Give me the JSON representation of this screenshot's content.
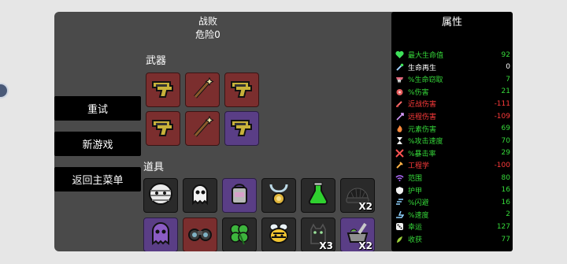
{
  "header": {
    "result": "战败",
    "danger": "危险0"
  },
  "menu": {
    "retry": "重试",
    "new_game": "新游戏",
    "main_menu": "返回主菜单"
  },
  "weapons": {
    "title": "武器",
    "items": [
      {
        "icon": "gun-icon",
        "tier": "red"
      },
      {
        "icon": "wand-icon",
        "tier": "red"
      },
      {
        "icon": "gun-icon",
        "tier": "red"
      },
      {
        "icon": "gun-icon",
        "tier": "red"
      },
      {
        "icon": "wand-icon",
        "tier": "red"
      },
      {
        "icon": "gun-icon",
        "tier": "purple"
      }
    ]
  },
  "items": {
    "title": "道具",
    "list": [
      {
        "icon": "mummy-head-icon",
        "tier": "gray",
        "qty": ""
      },
      {
        "icon": "ghost-icon",
        "tier": "gray",
        "qty": ""
      },
      {
        "icon": "canister-icon",
        "tier": "purple",
        "qty": ""
      },
      {
        "icon": "amulet-icon",
        "tier": "gray",
        "qty": ""
      },
      {
        "icon": "potion-flask-icon",
        "tier": "gray",
        "qty": ""
      },
      {
        "icon": "beanie-hat-icon",
        "tier": "gray",
        "qty": "X2"
      },
      {
        "icon": "purple-ghost-icon",
        "tier": "purple",
        "qty": ""
      },
      {
        "icon": "binoculars-icon",
        "tier": "red",
        "qty": ""
      },
      {
        "icon": "clover-icon",
        "tier": "gray",
        "qty": ""
      },
      {
        "icon": "bee-icon",
        "tier": "gray",
        "qty": ""
      },
      {
        "icon": "dark-cat-icon",
        "tier": "gray",
        "qty": "X3"
      },
      {
        "icon": "mortar-icon",
        "tier": "purple",
        "qty": "X2"
      }
    ]
  },
  "stats": {
    "title": "属性",
    "rows": [
      {
        "icon": "heart-icon",
        "label": "最大生命值",
        "value": "92",
        "color": "#36d93a"
      },
      {
        "icon": "regen-icon",
        "label": "生命再生",
        "value": "0",
        "color": "#ffffff"
      },
      {
        "icon": "lifesteal-icon",
        "label": "%生命窃取",
        "value": "7",
        "color": "#36d93a"
      },
      {
        "icon": "damage-icon",
        "label": "%伤害",
        "value": "21",
        "color": "#36d93a"
      },
      {
        "icon": "melee-icon",
        "label": "近战伤害",
        "value": "-111",
        "color": "#ff3b3b"
      },
      {
        "icon": "ranged-icon",
        "label": "远程伤害",
        "value": "-109",
        "color": "#ff3b3b"
      },
      {
        "icon": "elemental-icon",
        "label": "元素伤害",
        "value": "69",
        "color": "#36d93a"
      },
      {
        "icon": "attack-speed-icon",
        "label": "%攻击速度",
        "value": "70",
        "color": "#36d93a"
      },
      {
        "icon": "crit-icon",
        "label": "%暴击率",
        "value": "29",
        "color": "#36d93a"
      },
      {
        "icon": "engineering-icon",
        "label": "工程学",
        "value": "-100",
        "color": "#ff3b3b"
      },
      {
        "icon": "range-icon",
        "label": "范围",
        "value": "80",
        "color": "#36d93a"
      },
      {
        "icon": "armor-icon",
        "label": "护甲",
        "value": "16",
        "color": "#36d93a"
      },
      {
        "icon": "dodge-icon",
        "label": "%闪避",
        "value": "16",
        "color": "#36d93a"
      },
      {
        "icon": "speed-icon",
        "label": "%速度",
        "value": "2",
        "color": "#36d93a"
      },
      {
        "icon": "luck-icon",
        "label": "幸运",
        "value": "127",
        "color": "#36d93a"
      },
      {
        "icon": "harvest-icon",
        "label": "收获",
        "value": "77",
        "color": "#36d93a"
      }
    ]
  }
}
